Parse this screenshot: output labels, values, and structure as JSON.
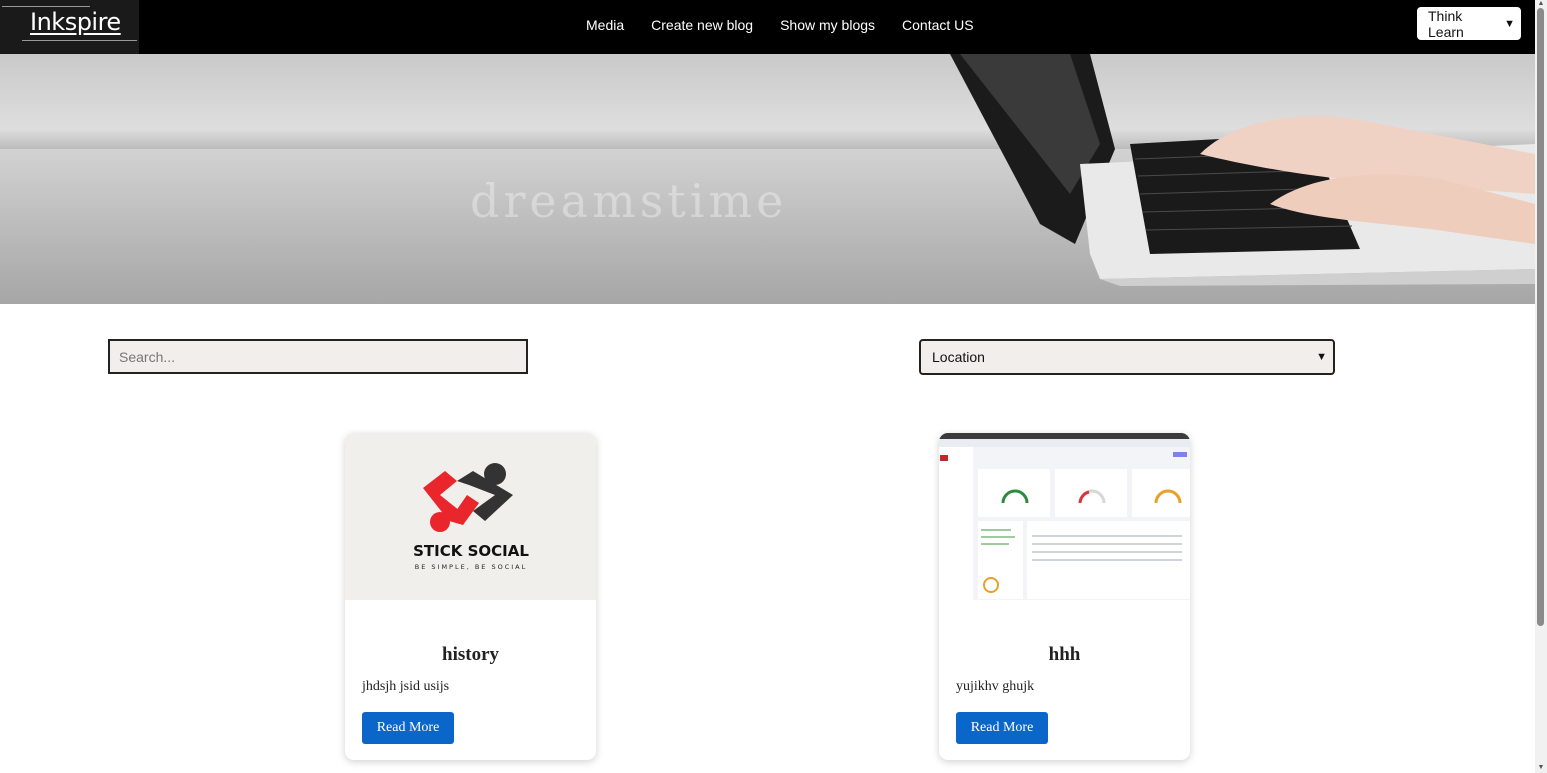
{
  "navbar": {
    "logo_text": "Inkspire",
    "links": [
      "Media",
      "Create new blog",
      "Show my blogs",
      "Contact US"
    ],
    "language_select": {
      "value": "Think Learn",
      "icon": "chevron-down-icon"
    }
  },
  "hero": {
    "image": "laptop-typing-hero-image",
    "watermark_text": "dreamstime"
  },
  "filters": {
    "search_placeholder": "Search...",
    "location_value": "Location"
  },
  "cards": [
    {
      "image": "stick-social-logo",
      "logo_title": "STICK SOCIAL",
      "logo_tagline": "BE SIMPLE, BE SOCIAL",
      "title": "history",
      "description": "jhdsjh jsid usijs",
      "button_label": "Read More"
    },
    {
      "image": "dashboard-screenshot",
      "title": "hhh",
      "description": "yujikhv ghujk",
      "button_label": "Read More"
    }
  ],
  "colors": {
    "navbar_bg": "#000000",
    "button_blue": "#0a66c8",
    "field_bg": "#f1eeec"
  }
}
